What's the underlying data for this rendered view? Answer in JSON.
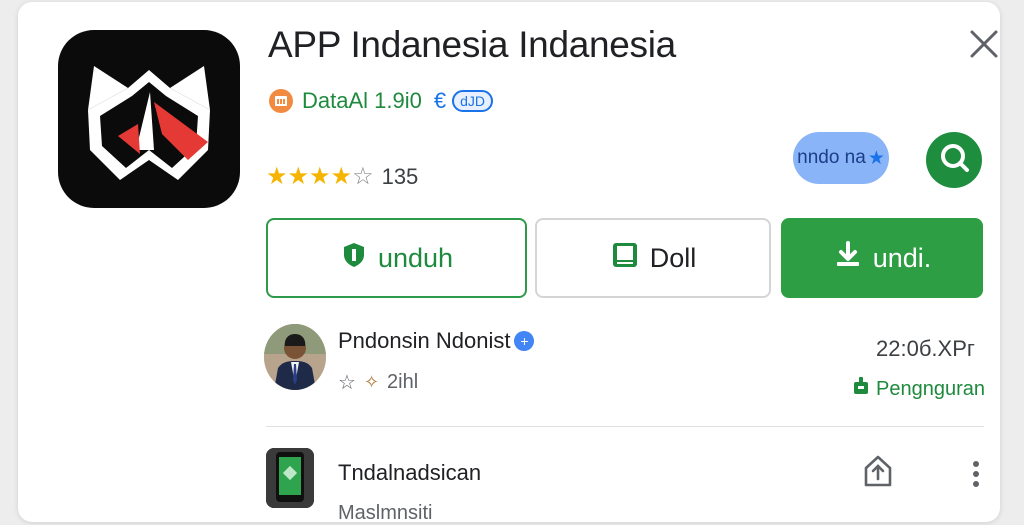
{
  "app": {
    "title": "APP Indanesia Indanesia",
    "meta_text": "DataAl 1.9i0",
    "meta_currency": "€",
    "meta_badge": "dJD",
    "rating": {
      "stars_filled": 4,
      "stars_total": 5,
      "count": "135"
    },
    "tag_label": "nndo na",
    "tag_mark": "★"
  },
  "buttons": {
    "primary_outline": "unduh",
    "secondary": "Doll",
    "primary_filled": "undi."
  },
  "developer": {
    "name": "Pndonsin Ndonist",
    "verified_mark": "+",
    "stats": "2ihl",
    "time": "22:0б.ХРг",
    "report_label": "Pengnguran"
  },
  "list_item": {
    "title": "Tndalnadsican",
    "subtitle": "Maslmnsiti"
  },
  "colors": {
    "accent_green": "#2d9e44",
    "accent_blue": "#1a73e8",
    "star": "#f5b400"
  },
  "icons": {
    "close": "close-icon",
    "shop": "shop-icon",
    "search": "search-icon",
    "install": "download-icon",
    "book": "book-icon",
    "report": "flag-icon",
    "share": "share-icon",
    "more": "more-vert-icon"
  }
}
